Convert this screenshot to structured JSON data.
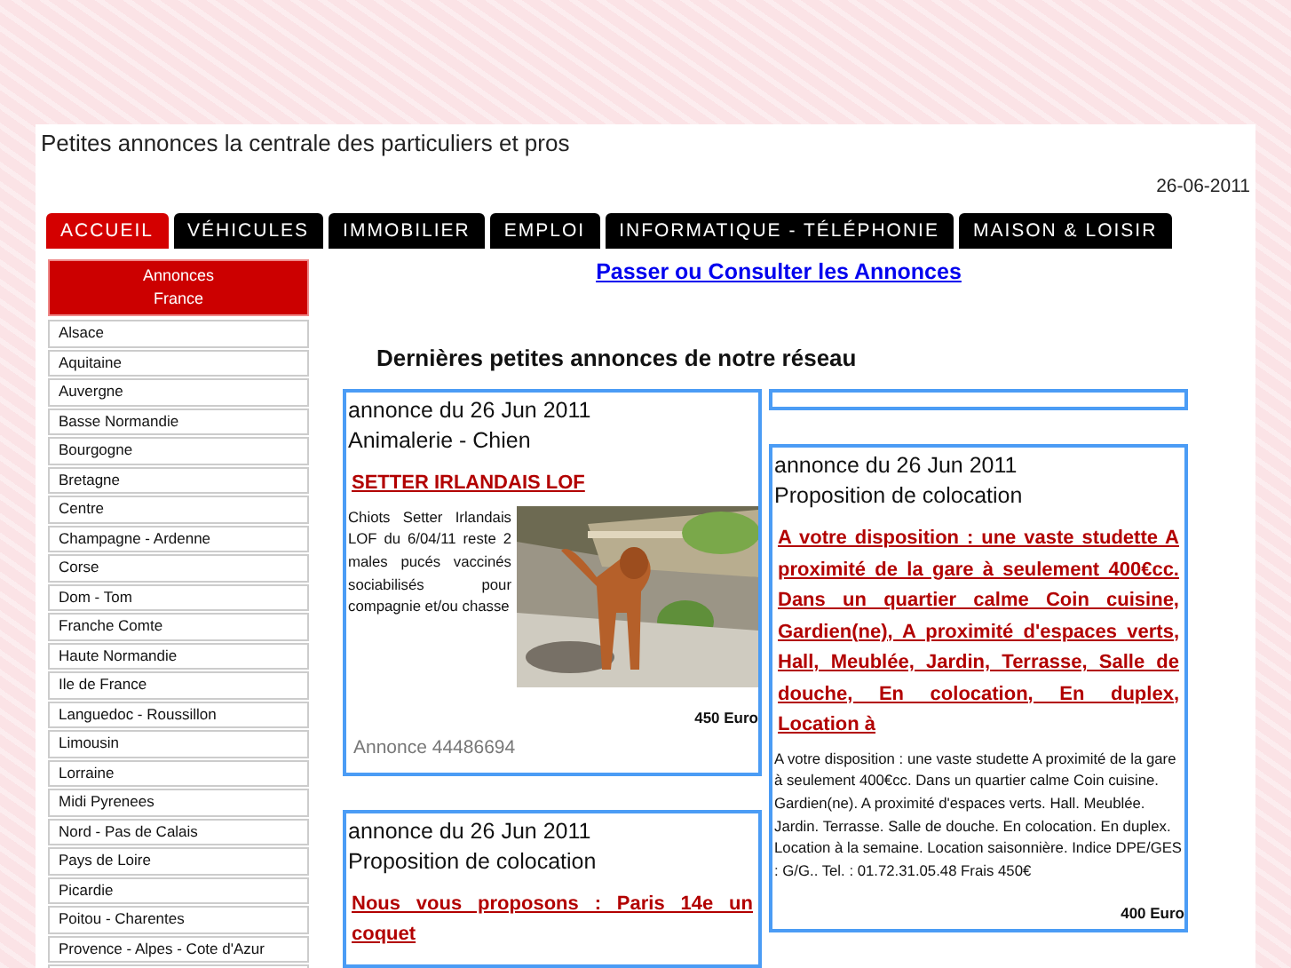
{
  "site_title": "Petites annonces la centrale des particuliers et pros",
  "date": "26-06-2011",
  "tabs": [
    {
      "label": "ACCUEIL",
      "selected": true
    },
    {
      "label": "VÉHICULES",
      "selected": false
    },
    {
      "label": "IMMOBILIER",
      "selected": false
    },
    {
      "label": "EMPLOI",
      "selected": false
    },
    {
      "label": "INFORMATIQUE - TÉLÉPHONIE",
      "selected": false
    },
    {
      "label": "MAISON & LOISIR",
      "selected": false
    }
  ],
  "sidebar": {
    "header": "Annonces France",
    "items": [
      "Alsace",
      "Aquitaine",
      "Auvergne",
      "Basse Normandie",
      "Bourgogne",
      "Bretagne",
      "Centre",
      "Champagne - Ardenne",
      "Corse",
      "Dom - Tom",
      "Franche Comte",
      "Haute Normandie",
      "Ile de France",
      "Languedoc - Roussillon",
      "Limousin",
      "Lorraine",
      "Midi Pyrenees",
      "Nord - Pas de Calais",
      "Pays de Loire",
      "Picardie",
      "Poitou - Charentes",
      "Provence - Alpes - Cote d'Azur"
    ]
  },
  "main": {
    "link": "Passer ou Consulter les Annonces",
    "heading": "Dernières petites annonces de notre réseau",
    "columns": [
      [
        {
          "kind": "ad",
          "date": "annonce du 26 Jun 2011",
          "category": "Animalerie - Chien",
          "title": "SETTER IRLANDAIS LOF",
          "description": "Chiots Setter Irlandais LOF du 6/04/11 reste 2 males pucés vaccinés sociabilisés pour compagnie et/ou chasse",
          "price": "450 Euro",
          "reference": "Annonce 44486694"
        },
        {
          "kind": "ad",
          "date": "annonce du 26 Jun 2011",
          "category": "Proposition de colocation",
          "title": "Nous vous proposons : Paris 14e un coquet"
        }
      ],
      [
        {
          "kind": "empty"
        },
        {
          "kind": "ad",
          "date": "annonce du 26 Jun 2011",
          "category": "Proposition de colocation",
          "title": "A votre disposition : une vaste studette A proximité de la gare à seulement 400€cc. Dans un quartier calme Coin cuisine, Gardien(ne), A proximité d'espaces verts, Hall, Meublée, Jardin, Terrasse, Salle de douche, En colocation, En duplex, Location à",
          "description": "A votre disposition : une vaste studette A proximité de la gare à seulement 400€cc. Dans un quartier calme Coin cuisine. Gardien(ne). A proximité d'espaces verts. Hall. Meublée. Jardin. Terrasse. Salle de douche. En colocation. En duplex. Location à la semaine. Location saisonnière. Indice DPE/GES : G/G.. Tel. : 01.72.31.05.48 Frais 450€",
          "price": "400 Euro"
        }
      ]
    ]
  }
}
